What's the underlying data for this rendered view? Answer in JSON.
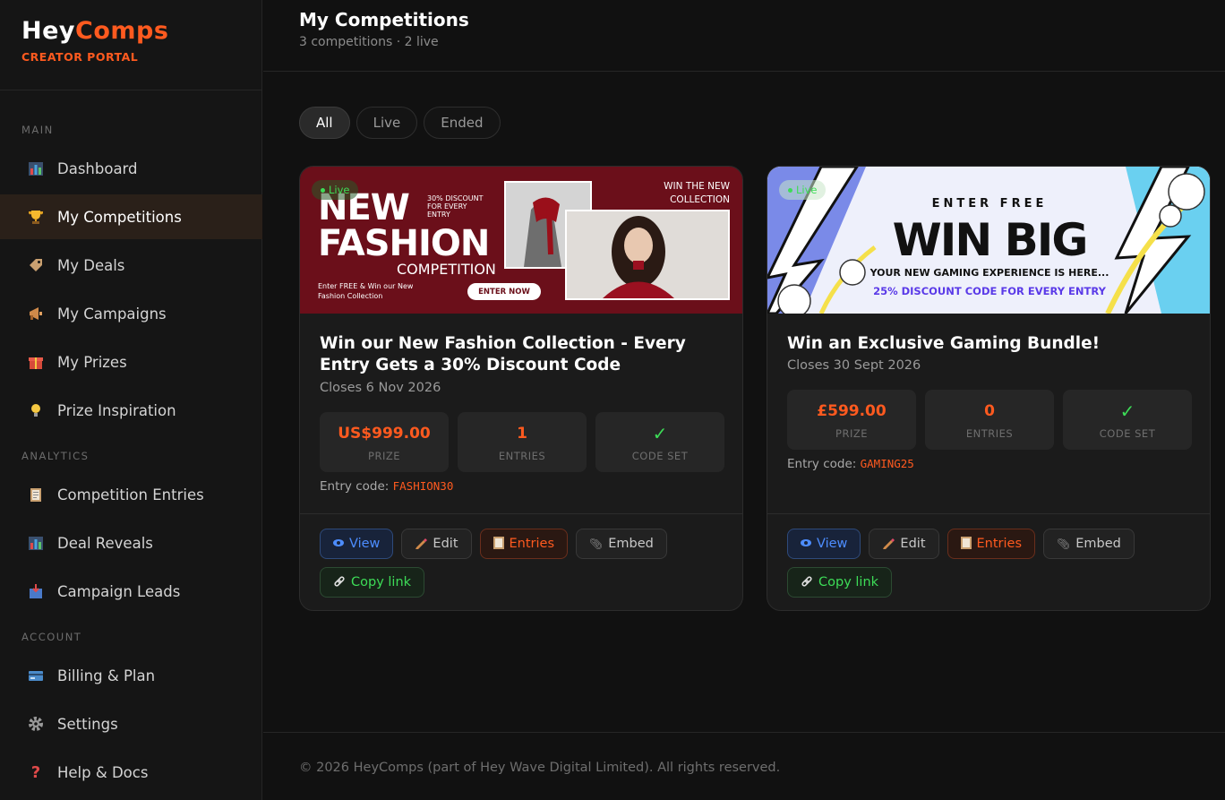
{
  "brand": {
    "hey": "Hey",
    "comps": "Comps",
    "subtitle": "CREATOR PORTAL"
  },
  "sidebar": {
    "sections": [
      "MAIN",
      "ANALYTICS",
      "ACCOUNT"
    ],
    "items": [
      {
        "label": "Dashboard",
        "icon": "bar-chart-icon"
      },
      {
        "label": "My Competitions",
        "icon": "trophy-icon",
        "active": true
      },
      {
        "label": "My Deals",
        "icon": "tag-icon"
      },
      {
        "label": "My Campaigns",
        "icon": "megaphone-icon"
      },
      {
        "label": "My Prizes",
        "icon": "gift-icon"
      },
      {
        "label": "Prize Inspiration",
        "icon": "lightbulb-icon"
      },
      {
        "label": "Competition Entries",
        "icon": "clipboard-icon"
      },
      {
        "label": "Deal Reveals",
        "icon": "bar-chart-icon"
      },
      {
        "label": "Campaign Leads",
        "icon": "inbox-icon"
      },
      {
        "label": "Billing & Plan",
        "icon": "credit-card-icon"
      },
      {
        "label": "Settings",
        "icon": "gear-icon"
      },
      {
        "label": "Help & Docs",
        "icon": "question-icon"
      }
    ]
  },
  "header": {
    "title": "My Competitions",
    "subtitle": "3 competitions · 2 live"
  },
  "filters": [
    {
      "label": "All",
      "active": true
    },
    {
      "label": "Live",
      "active": false
    },
    {
      "label": "Ended",
      "active": false
    }
  ],
  "cards": [
    {
      "badge": "Live",
      "banner": {
        "headline_1": "NEW",
        "headline_2": "FASHION",
        "headline_3": "COMPETITION",
        "discount": "30% DISCOUNT FOR EVERY ENTRY",
        "win": "WIN THE NEW COLLECTION",
        "small": "Enter FREE & Win our New Fashion Collection",
        "cta": "ENTER NOW"
      },
      "title": "Win our New Fashion Collection - Every Entry Gets a 30% Discount Code",
      "closes": "Closes 6 Nov 2026",
      "stats": [
        {
          "value": "US$999.00",
          "label": "PRIZE"
        },
        {
          "value": "1",
          "label": "ENTRIES"
        },
        {
          "value": "✓",
          "label": "CODE SET"
        }
      ],
      "entry_code_label": "Entry code:",
      "entry_code": "FASHION30",
      "actions": [
        "View",
        "Edit",
        "Entries",
        "Embed",
        "Copy link"
      ]
    },
    {
      "badge": "Live",
      "banner": {
        "enter": "ENTER FREE",
        "headline": "WIN BIG",
        "line1": "YOUR NEW GAMING EXPERIENCE IS HERE...",
        "line2": "25% DISCOUNT CODE FOR EVERY ENTRY"
      },
      "title": "Win an Exclusive Gaming Bundle!",
      "closes": "Closes 30 Sept 2026",
      "stats": [
        {
          "value": "£599.00",
          "label": "PRIZE"
        },
        {
          "value": "0",
          "label": "ENTRIES"
        },
        {
          "value": "✓",
          "label": "CODE SET"
        }
      ],
      "entry_code_label": "Entry code:",
      "entry_code": "GAMING25",
      "actions": [
        "View",
        "Edit",
        "Entries",
        "Embed",
        "Copy link"
      ]
    }
  ],
  "footer": {
    "text": "© 2026 HeyComps (part of Hey Wave Digital Limited). All rights reserved."
  },
  "colors": {
    "accent": "#ff5a1f",
    "live": "#3ddc57",
    "link": "#4d8dff",
    "fashion_bg": "#6b0f1a"
  }
}
